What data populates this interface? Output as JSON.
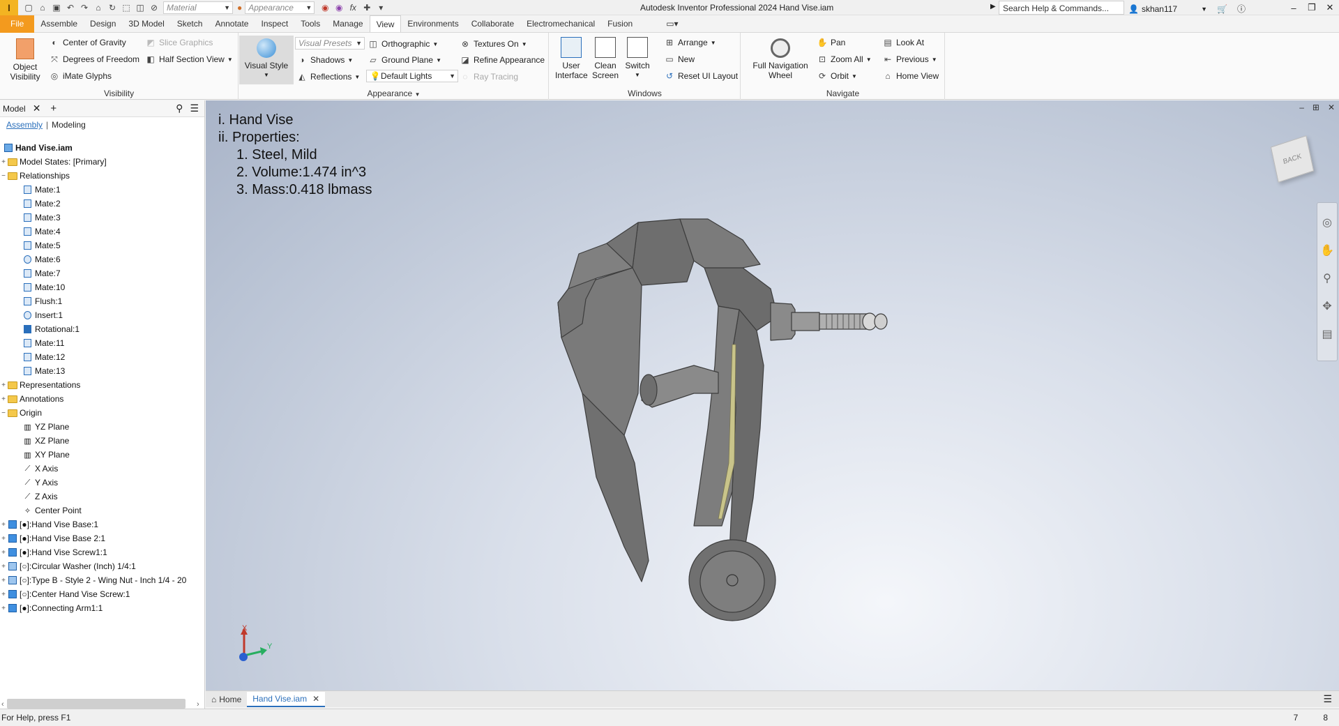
{
  "app": {
    "logo_letter": "I",
    "title": "Autodesk Inventor Professional 2024   Hand Vise.iam",
    "material_placeholder": "Material",
    "appearance_placeholder": "Appearance",
    "search_placeholder": "Search Help & Commands...",
    "user": "skhan117"
  },
  "menu": [
    "File",
    "Assemble",
    "Design",
    "3D Model",
    "Sketch",
    "Annotate",
    "Inspect",
    "Tools",
    "Manage",
    "View",
    "Environments",
    "Collaborate",
    "Electromechanical",
    "Fusion"
  ],
  "ribbon": {
    "visibility": {
      "object_visibility": "Object Visibility",
      "center_of_gravity": "Center of Gravity",
      "degrees_of_freedom": "Degrees of Freedom",
      "imate_glyphs": "iMate Glyphs",
      "slice_graphics": "Slice Graphics",
      "half_section_view": "Half Section View",
      "title": "Visibility"
    },
    "appearance": {
      "visual_style": "Visual Style",
      "visual_presets": "Visual Presets",
      "shadows": "Shadows",
      "reflections": "Reflections",
      "orthographic": "Orthographic",
      "ground_plane": "Ground Plane",
      "default_lights": "Default Lights",
      "textures_on": "Textures On",
      "refine_appearance": "Refine Appearance",
      "ray_tracing": "Ray Tracing",
      "title": "Appearance"
    },
    "windows": {
      "user_interface": "User Interface",
      "clean_screen": "Clean Screen",
      "switch": "Switch",
      "arrange": "Arrange",
      "new": "New",
      "reset_ui_layout": "Reset UI Layout",
      "title": "Windows"
    },
    "navigate": {
      "full_navigation_wheel": "Full Navigation Wheel",
      "pan": "Pan",
      "zoom_all": "Zoom All",
      "orbit": "Orbit",
      "look_at": "Look At",
      "previous": "Previous",
      "home_view": "Home View",
      "title": "Navigate"
    }
  },
  "browser": {
    "tab": "Model",
    "assembly": "Assembly",
    "modeling": "Modeling",
    "root": "Hand Vise.iam",
    "model_states": "Model States: [Primary]",
    "relationships": "Relationships",
    "relations": [
      "Mate:1",
      "Mate:2",
      "Mate:3",
      "Mate:4",
      "Mate:5",
      "Mate:6",
      "Mate:7",
      "Mate:10",
      "Flush:1",
      "Insert:1",
      "Rotational:1",
      "Mate:11",
      "Mate:12",
      "Mate:13"
    ],
    "representations": "Representations",
    "annotations": "Annotations",
    "origin": "Origin",
    "origin_items": [
      "YZ Plane",
      "XZ Plane",
      "XY Plane",
      "X Axis",
      "Y Axis",
      "Z Axis",
      "Center Point"
    ],
    "components": [
      "[●]:Hand Vise Base:1",
      "[●]:Hand Vise Base 2:1",
      "[●]:Hand Vise Screw1:1",
      "[○]:Circular Washer (Inch) 1/4:1",
      "[○]:Type B - Style 2 - Wing Nut - Inch 1/4 - 20",
      "[○]:Center Hand Vise Screw:1",
      "[●]:Connecting Arm1:1"
    ]
  },
  "viewport": {
    "line1": "i. Hand Vise",
    "line2": "ii. Properties:",
    "prop1": "1. Steel, Mild",
    "prop2": "2. Volume:1.474 in^3",
    "prop3": "3. Mass:0.418 lbmass",
    "viewcube_label": "BACK",
    "triad_x": "X",
    "triad_y": "Y"
  },
  "doctabs": {
    "home": "Home",
    "active": "Hand Vise.iam"
  },
  "status": {
    "help": "For Help, press F1",
    "num1": "7",
    "num2": "8"
  }
}
